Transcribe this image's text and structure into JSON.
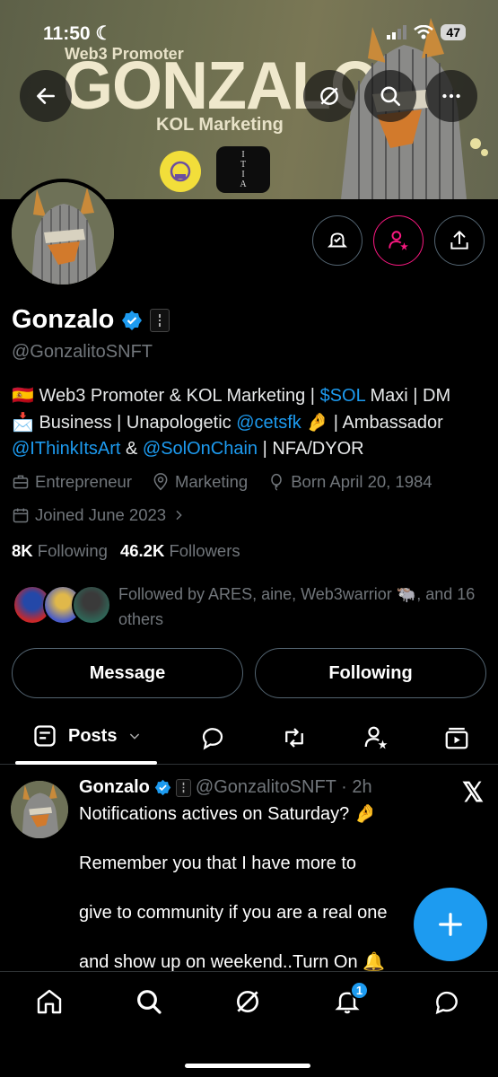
{
  "status_bar": {
    "time": "11:50",
    "battery": "47"
  },
  "banner": {
    "line1": "Web3 Promoter",
    "title": "GONZALO",
    "line2": "KOL Marketing",
    "logo2_letters": [
      "I",
      "T",
      "I",
      "A"
    ]
  },
  "profile": {
    "name": "Gonzalo",
    "handle": "@GonzalitoSNFT",
    "bio": {
      "flag": "🇪🇸",
      "t1": " Web3 Promoter & KOL Marketing | ",
      "cashtag": "$SOL",
      "t2": " Maxi | DM ",
      "inbox": "📩",
      "t3": " Business | Unapologetic ",
      "mention1": "@cetsfk",
      "emoji": "🤌",
      "t4": " | Ambassador ",
      "mention2": "@IThinkItsArt",
      "t5": " & ",
      "mention3": "@SolOnChain",
      "t6": " | NFA/DYOR"
    },
    "category": "Entrepreneur",
    "location": "Marketing",
    "born": "Born April 20, 1984",
    "joined": "Joined June 2023",
    "following_count": "8K",
    "following_label": "Following",
    "followers_count": "46.2K",
    "followers_label": "Followers",
    "followed_by": "Followed by ARES, aine, Web3warrior 🐃, and 16 others"
  },
  "buttons": {
    "message": "Message",
    "following": "Following"
  },
  "tabs": {
    "posts": "Posts"
  },
  "post": {
    "name": "Gonzalo",
    "meta": "@GonzalitoSNFT · 2h",
    "line1": "Notifications actives on Saturday? 🤌",
    "line2": "Remember you that I have more to",
    "line3": "give to community if you are a real one",
    "line4": "and show up on weekend..Turn On 🔔",
    "logo": "𝕏"
  },
  "nav": {
    "notification_count": "1"
  },
  "colors": {
    "accent": "#1d9bf0",
    "pink": "#f91880",
    "muted": "#71767b"
  }
}
